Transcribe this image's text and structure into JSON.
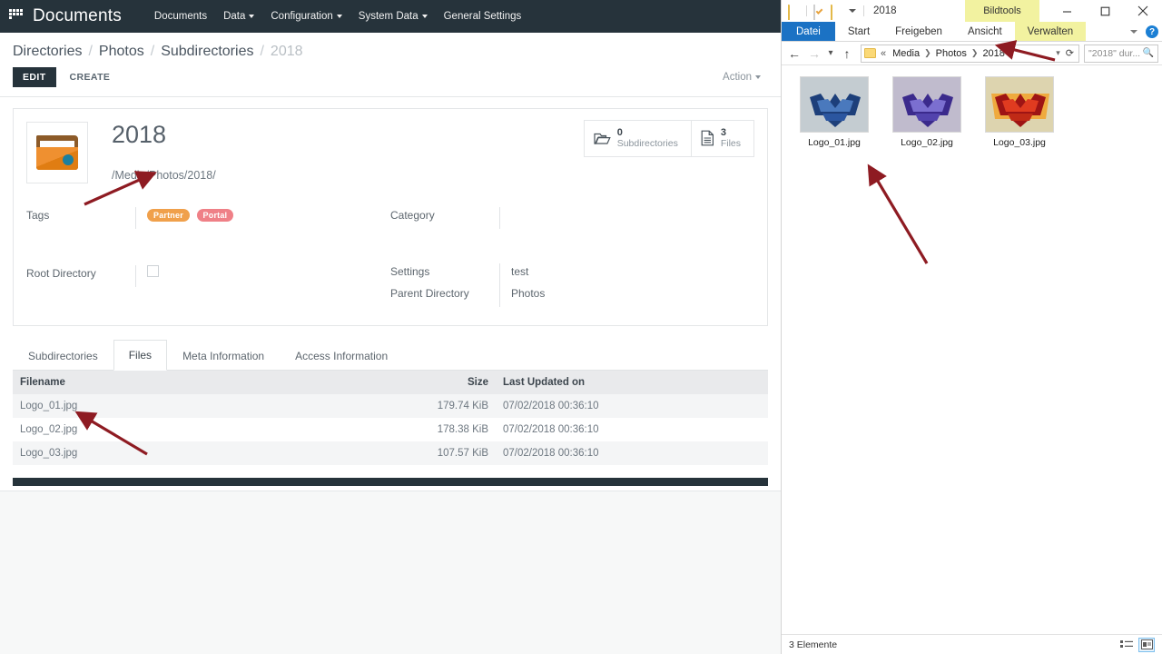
{
  "app": {
    "navbar": {
      "brand": "Documents",
      "menu": [
        {
          "label": "Documents",
          "caret": false
        },
        {
          "label": "Data",
          "caret": true
        },
        {
          "label": "Configuration",
          "caret": true
        },
        {
          "label": "System Data",
          "caret": true
        },
        {
          "label": "General Settings",
          "caret": false
        }
      ]
    },
    "breadcrumb": [
      "Directories",
      "Photos",
      "Subdirectories",
      "2018"
    ],
    "toolbar": {
      "edit_label": "EDIT",
      "create_label": "CREATE",
      "action_label": "Action"
    },
    "detail": {
      "title": "2018",
      "path": "/Media/Photos/2018/",
      "counters": [
        {
          "num": "0",
          "label": "Subdirectories",
          "icon": "folder-open-icon"
        },
        {
          "num": "3",
          "label": "Files",
          "icon": "file-icon"
        }
      ],
      "fields": {
        "tags_label": "Tags",
        "tags": [
          {
            "text": "Partner",
            "color": "#f0a04b"
          },
          {
            "text": "Portal",
            "color": "#ef8087"
          }
        ],
        "root_directory_label": "Root Directory",
        "root_directory_checked": false,
        "category_label": "Category",
        "category_value": "",
        "settings_label": "Settings",
        "settings_value": "test",
        "parent_directory_label": "Parent Directory",
        "parent_directory_value": "Photos"
      }
    },
    "tabs": [
      {
        "label": "Subdirectories",
        "active": false
      },
      {
        "label": "Files",
        "active": true
      },
      {
        "label": "Meta Information",
        "active": false
      },
      {
        "label": "Access Information",
        "active": false
      }
    ],
    "files_table": {
      "columns": [
        "Filename",
        "Size",
        "Last Updated on"
      ],
      "rows": [
        {
          "filename": "Logo_01.jpg",
          "size": "179.74 KiB",
          "updated": "07/02/2018 00:36:10"
        },
        {
          "filename": "Logo_02.jpg",
          "size": "178.38 KiB",
          "updated": "07/02/2018 00:36:10"
        },
        {
          "filename": "Logo_03.jpg",
          "size": "107.57 KiB",
          "updated": "07/02/2018 00:36:10"
        }
      ]
    }
  },
  "explorer": {
    "title": "2018",
    "contextual_tab": "Bildtools",
    "ribbon_tabs": [
      "Datei",
      "Start",
      "Freigeben",
      "Ansicht",
      "Verwalten"
    ],
    "address": {
      "segments": [
        "Media",
        "Photos",
        "2018"
      ],
      "prefix": "«",
      "search_placeholder": "\"2018\" dur..."
    },
    "items": [
      {
        "name": "Logo_01.jpg"
      },
      {
        "name": "Logo_02.jpg"
      },
      {
        "name": "Logo_03.jpg"
      }
    ],
    "status": "3 Elemente"
  },
  "colors": {
    "navbar_bg": "#26333b",
    "accent_blue": "#1b72c4",
    "contextual_yellow": "#f2f2a0",
    "annotation_red": "#8e1b22"
  }
}
